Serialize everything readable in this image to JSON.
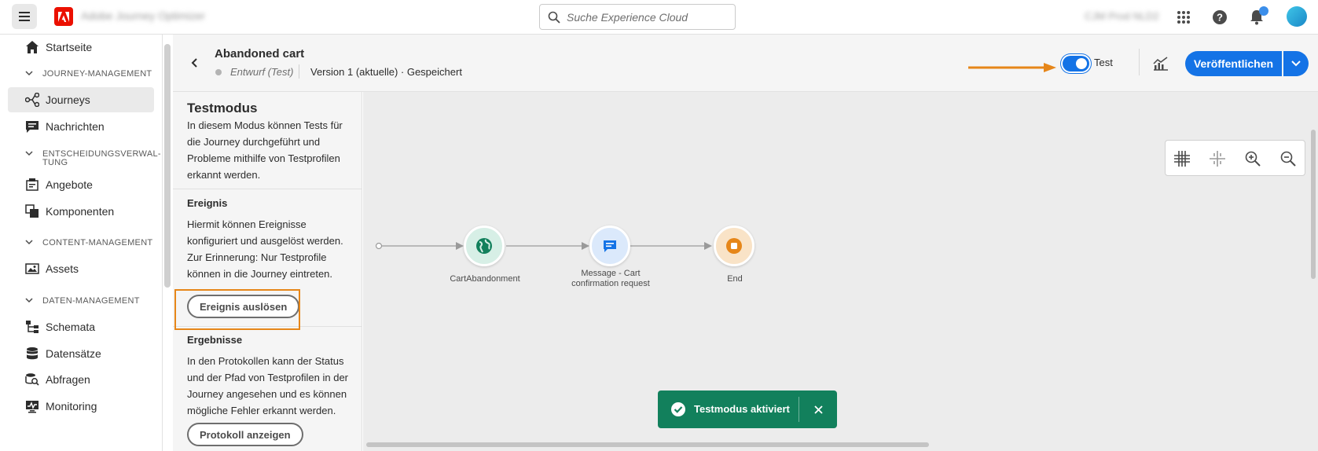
{
  "app": {
    "title": "Adobe Journey Optimizer",
    "org": "CJM Prod NLD2"
  },
  "search": {
    "placeholder": "Suche Experience Cloud"
  },
  "sidebar": {
    "items": [
      {
        "label": "Startseite"
      },
      {
        "label": "Journeys"
      },
      {
        "label": "Nachrichten"
      },
      {
        "label": "Angebote"
      },
      {
        "label": "Komponenten"
      },
      {
        "label": "Assets"
      },
      {
        "label": "Schemata"
      },
      {
        "label": "Datensätze"
      },
      {
        "label": "Abfragen"
      },
      {
        "label": "Monitoring"
      }
    ],
    "sections": [
      {
        "label": "JOURNEY-MANAGEMENT"
      },
      {
        "label": "ENTSCHEIDUNGSVERWAL-"
      },
      {
        "label": "TUNG"
      },
      {
        "label": "CONTENT-MANAGEMENT"
      },
      {
        "label": "DATEN-MANAGEMENT"
      }
    ]
  },
  "journey": {
    "name": "Abandoned cart",
    "status": "Entwurf (Test)",
    "version": "Version 1 (aktuelle) · Gespeichert",
    "test_label": "Test",
    "test_mode_on": true,
    "publish_label": "Veröffentlichen"
  },
  "test_panel": {
    "title": "Testmodus",
    "intro": "In diesem Modus können Tests für die Journey durchgeführt und Probleme mithilfe von Testprofilen erkannt werden.",
    "event_heading": "Ereignis",
    "event_text": "Hiermit können Ereignisse konfiguriert und ausgelöst werden. Zur Erinnerung: Nur Testprofile können in die Journey eintreten.",
    "trigger_button": "Ereignis auslösen",
    "results_heading": "Ergebnisse",
    "results_text": "In den Protokollen kann der Status und der Pfad von Testprofilen in der Journey angesehen und es können mögliche Fehler erkannt werden.",
    "log_button": "Protokoll anzeigen"
  },
  "canvas": {
    "nodes": [
      {
        "label": "CartAbandonment",
        "icon": "globe-icon",
        "color": "#d7efe6"
      },
      {
        "label": "Message - Cart confirmation request",
        "icon": "message-icon",
        "color": "#dbe9fb"
      },
      {
        "label": "End",
        "icon": "stop-icon",
        "color": "#f9e3c7"
      }
    ]
  },
  "toast": {
    "text": "Testmodus aktiviert"
  },
  "colors": {
    "accent": "#1473e6",
    "success": "#12805c",
    "highlight": "#e68619"
  }
}
